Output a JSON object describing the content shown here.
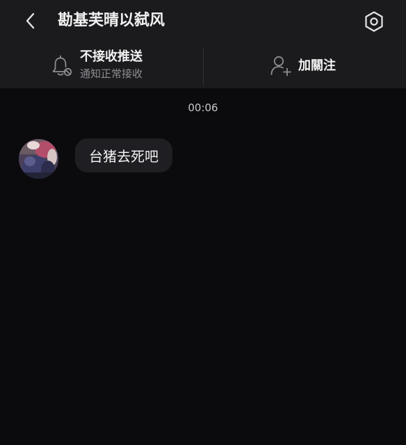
{
  "header": {
    "title": "勘基芙晴以弑风",
    "back_icon": "chevron-left-icon",
    "settings_icon": "hexagon-settings-icon"
  },
  "actions": {
    "mute": {
      "icon": "bell-off-icon",
      "title": "不接收推送",
      "subtitle": "通知正常接收"
    },
    "follow": {
      "icon": "user-plus-icon",
      "label": "加關注"
    }
  },
  "chat": {
    "timestamp": "00:06",
    "messages": [
      {
        "sender": "incoming",
        "text": "台猪去死吧"
      }
    ]
  },
  "colors": {
    "background": "#0b0b0e",
    "header_background": "#1b1b1e",
    "bubble_background": "#1f1f23",
    "primary_text": "#f2f2f2",
    "secondary_text": "#8d8d93"
  }
}
